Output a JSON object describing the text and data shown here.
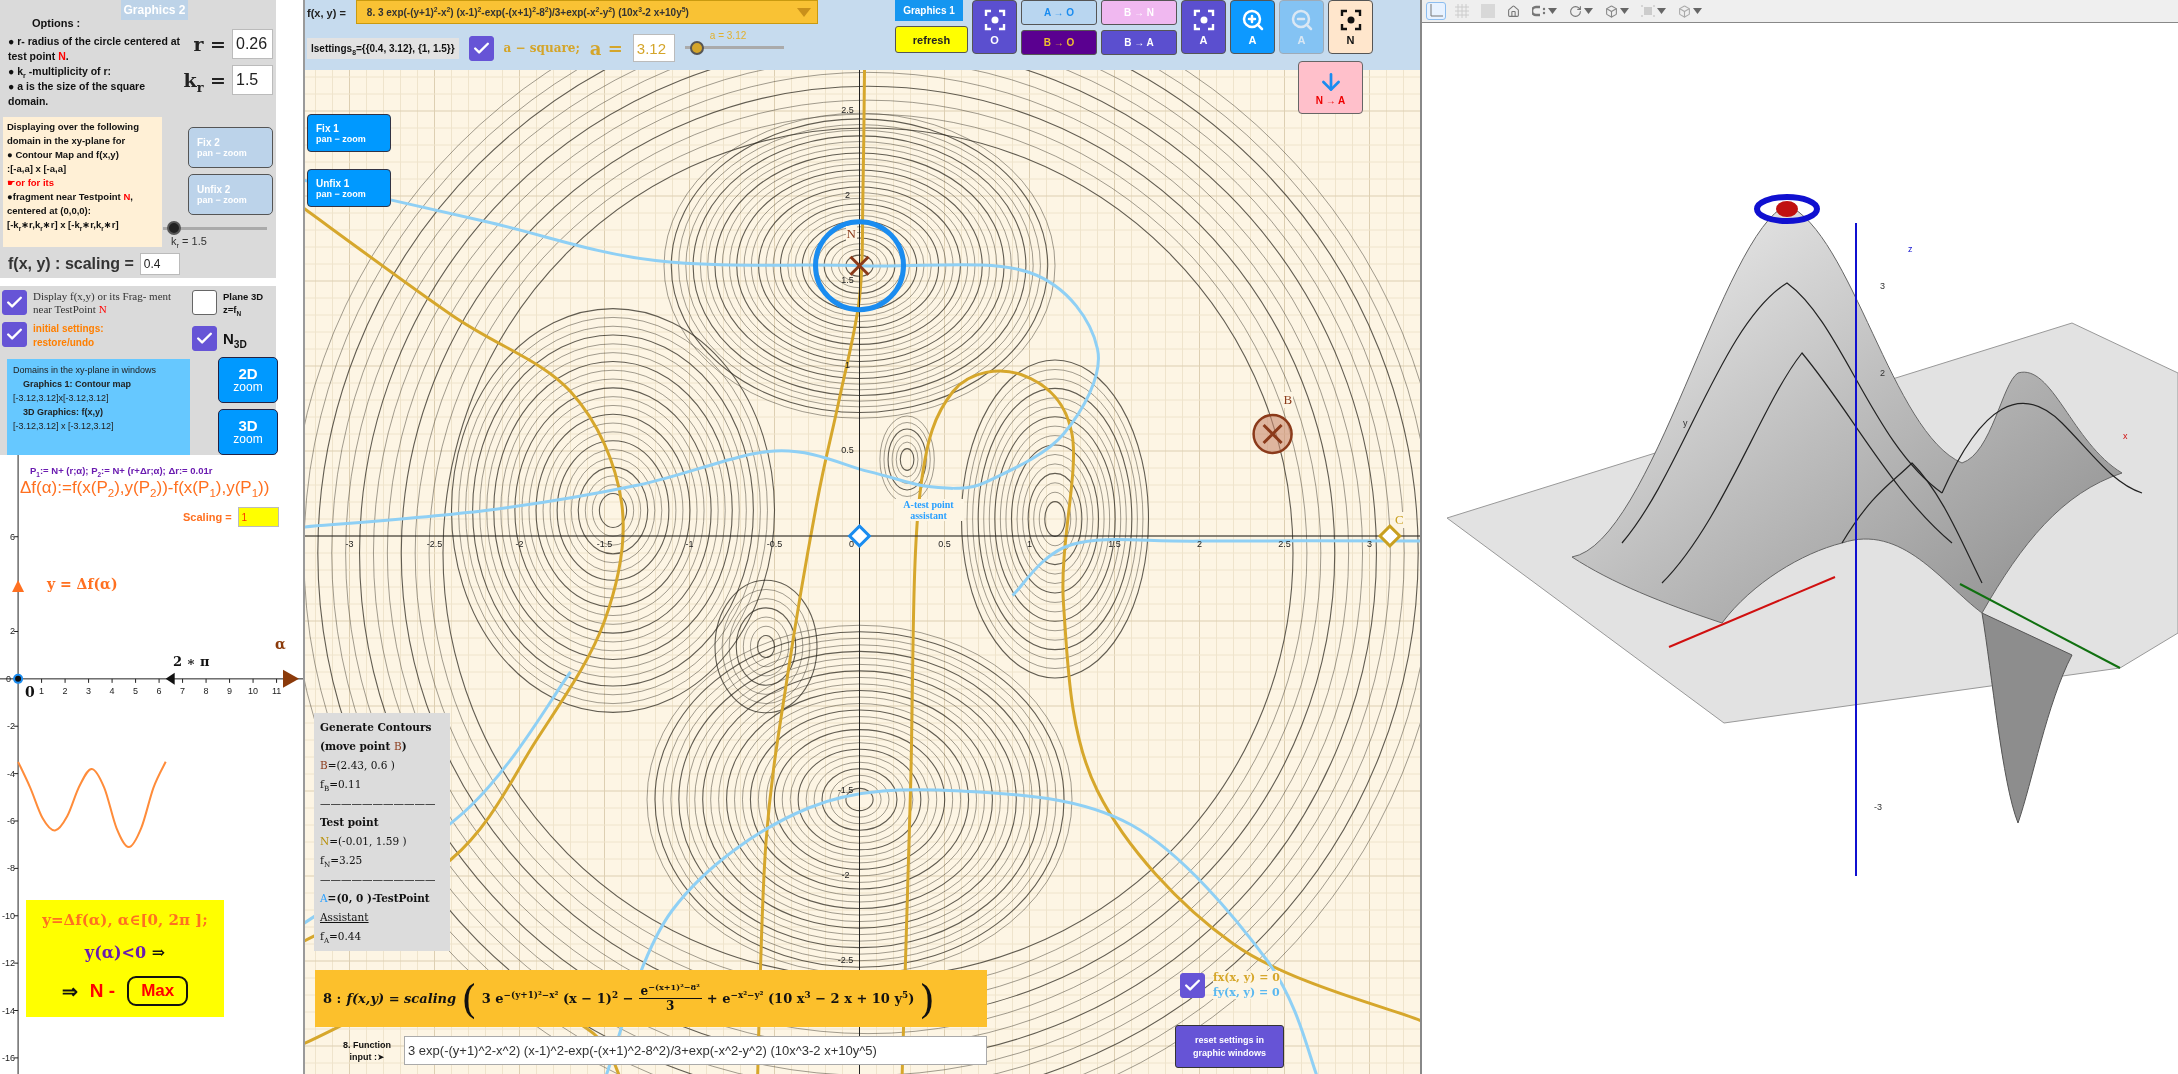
{
  "graphics2": {
    "tab_label": "Graphics 2",
    "options_title": "Options :",
    "option_lines": [
      [
        {
          "t": "● r- radius of the circle centered at test point ",
          "kind": "plain"
        },
        {
          "t": "N",
          "kind": "red"
        },
        {
          "t": ".",
          "kind": "plain"
        }
      ],
      [
        {
          "t": "● k$_{r}$ -multiplicity of  r:",
          "kind": "plain"
        }
      ],
      [
        {
          "t": "● a is the size of the square domain.",
          "kind": "plain"
        }
      ]
    ],
    "r_field": {
      "label": "r =",
      "value": "0.26"
    },
    "kr_field": {
      "label": "k$_{r}$ =",
      "value": "1.5"
    },
    "domain_note": [
      [
        {
          "t": "Displaying over the following domain in the xy-plane for",
          "kind": "plain"
        }
      ],
      [
        {
          "t": "● Contour Map and f(x,y)",
          "kind": "plain"
        }
      ],
      [
        {
          "t": ":[-a,a] x [-a,a]",
          "kind": "plain"
        }
      ],
      [
        {
          "t": "☛or for its",
          "kind": "red"
        }
      ],
      [
        {
          "t": "●fragment near Testpoint ",
          "kind": "plain"
        },
        {
          "t": "N",
          "kind": "red"
        },
        {
          "t": ",",
          "kind": "plain"
        }
      ],
      [
        {
          "t": "centered  at (0,0,0):",
          "kind": "plain"
        }
      ],
      [
        {
          "t": "[-k$_{r}$∗r,k$_{r}$∗r] x [-k$_{r}$∗r,k$_{r}$∗r]",
          "kind": "plain"
        }
      ]
    ],
    "fix_buttons": [
      {
        "title": "Fix 2",
        "subtitle": "pan − zoom"
      },
      {
        "title": "Unfix 2",
        "subtitle": "pan − zoom"
      }
    ],
    "kr_slider": {
      "level": 0.11,
      "label": "k$_{r}$ = 1.5"
    },
    "scaling": {
      "label": "f(x, y) :  scaling =",
      "value": "0.4"
    },
    "display_check": {
      "checked": true,
      "text": [
        {
          "t": "Display  f(x,y) or its Frag- ment near TestPoint ",
          "kind": "plain"
        },
        {
          "t": "N",
          "kind": "red"
        }
      ]
    },
    "initial_check": {
      "checked": true,
      "text": "initial settings: restore/undo"
    },
    "plane_check": {
      "checked": false,
      "text": "Plane 3D z=f$_{N}$"
    },
    "n3d_check": {
      "checked": true,
      "text": "N$_{3D}$"
    },
    "domains_box": [
      {
        "t": "Domains in the xy-plane in windows",
        "kind": "plain"
      },
      {
        "t": "Graphics 1: Contour map",
        "kind": "heading"
      },
      {
        "t": "[-3.12,3.12]x[-3.12,3.12]",
        "kind": "plain"
      },
      {
        "t": "3D Graphics: f(x,y)",
        "kind": "heading"
      },
      {
        "t": "[-3.12,3.12] x [-3.12,3.12]",
        "kind": "plain"
      }
    ],
    "zoom_buttons": [
      {
        "title": "2D",
        "subtitle": "zoom"
      },
      {
        "title": "3D",
        "subtitle": "zoom"
      }
    ],
    "graph": {
      "p_def": "P$_{1}$:= N+ (r;α);  P$_{2}$:= N+ (r+Δr;α); Δr:= 0.01r",
      "delta_def": "Δf(α):=f(x(P$_{2}$),y(P$_{2}$))-f(x(P$_{1}$),y(P$_{1}$))",
      "scaling_label": "Scaling =",
      "scaling_value": "1",
      "curve_label": "y = Δf(α)",
      "alpha_label": "α",
      "two_pi_label": "2 ∗ π",
      "origin_label": "0",
      "chart_data": {
        "type": "line",
        "x": [
          0,
          0.52,
          1.05,
          1.57,
          2.09,
          2.62,
          3.14,
          3.67,
          4.19,
          4.71,
          5.24,
          5.76,
          6.28
        ],
        "series": [
          {
            "color": "#ff8c3a",
            "values": [
              -3.5,
              -4.6,
              -5.9,
              -6.4,
              -5.8,
              -4.5,
              -3.8,
              -4.6,
              -6.3,
              -7.1,
              -6.3,
              -4.6,
              -3.5
            ]
          }
        ],
        "xlim": [
          -0.77,
          12.21
        ],
        "ylim": [
          -16.68,
          9.45
        ],
        "xticks": [
          1,
          2,
          3,
          4,
          5,
          6,
          7,
          8,
          9,
          10,
          11
        ],
        "yticks": [
          -16,
          -14,
          -12,
          -10,
          -8,
          -6,
          -4,
          -2,
          0,
          2,
          6
        ]
      },
      "conclusion": {
        "condition": "y=Δf(α), α∈[0, 2π ];",
        "implication": [
          {
            "t": "y(α)<0 ",
            "kind": "purple"
          },
          {
            "t": "⇒",
            "kind": "plain"
          }
        ],
        "arrow": "⇒",
        "point": "N -",
        "result": "Max"
      }
    }
  },
  "graphics1": {
    "function_label": "f(x, y) =",
    "function_dropdown": "8.  3 exp(-(y+1)$^{2}$-x$^{2}$) (x-1)$^{2}$-exp(-(x+1)$^{2}$-8$^{2}$)/3+exp(-x$^{2}$-y$^{2}$) (10x$^{3}$-2 x+10y$^{5}$)",
    "settings_text": "lsettings$_{8}$={{0.4, 3.12}, {1, 1.5}}",
    "square_check": {
      "checked": true,
      "text": "a − square;"
    },
    "a_field": {
      "label": "a =",
      "value": "3.12"
    },
    "a_slider": {
      "level": 0.12,
      "label": "a = 3.12"
    },
    "view_label": "Graphics 1",
    "refresh_button": "refresh",
    "frame_o": {
      "caption": "O"
    },
    "moves": [
      {
        "top": "A → O",
        "bottom": "B → O"
      },
      {
        "top": "B → N",
        "bottom": "B → A"
      }
    ],
    "frame_a": {
      "caption": "A"
    },
    "zoom_in": {
      "caption": "A",
      "disabled": false
    },
    "zoom_out": {
      "caption": "A",
      "disabled": true
    },
    "frame_n": {
      "caption": "N"
    },
    "n_to_a": {
      "caption": "N → A"
    },
    "fix_buttons": [
      {
        "title": "Fix 1",
        "subtitle": "pan − zoom"
      },
      {
        "title": "Unfix 1",
        "subtitle": "pan − zoom"
      }
    ],
    "x_ticks": [
      "-3",
      "-2.5",
      "-2",
      "-1.5",
      "-1",
      "-0.5",
      "0",
      "0.5",
      "1",
      "1.5",
      "2",
      "2.5",
      "3"
    ],
    "y_ticks_upper": [
      "2.5",
      "2",
      "1.5",
      "1",
      "0.5"
    ],
    "y_ticks_lower": [
      "-1.5",
      "-2",
      "-2.5"
    ],
    "point_labels": [
      "N",
      "B",
      "C"
    ],
    "assistant_label": "A-test point assistant",
    "info_box": [
      [
        {
          "t": "Generate Contours",
          "kind": "bold"
        }
      ],
      [
        {
          "t": "(move point  ",
          "kind": "bold"
        },
        {
          "t": "B",
          "kind": "brown"
        },
        {
          "t": ")",
          "kind": "bold"
        }
      ],
      [
        {
          "t": "B",
          "kind": "brown"
        },
        {
          "t": "=(2.43, 0.6 )",
          "kind": "value"
        }
      ],
      [
        {
          "t": "f$_{B}$=0.11",
          "kind": "value"
        }
      ],
      [
        {
          "t": "———————————",
          "kind": "plain"
        }
      ],
      [
        {
          "t": "Test point",
          "kind": "bold"
        }
      ],
      [
        {
          "t": "N",
          "kind": "gold"
        },
        {
          "t": "=(-0.01, 1.59 )",
          "kind": "value"
        }
      ],
      [
        {
          "t": "f$_{N}$=3.25",
          "kind": "value"
        }
      ],
      [
        {
          "t": "———————————",
          "kind": "plain"
        }
      ],
      [
        {
          "t": "A",
          "kind": "blue"
        },
        {
          "t": "=(0, 0 )-TestPoint",
          "kind": "bold"
        }
      ],
      [
        {
          "t": "Assistant",
          "kind": "underline"
        }
      ],
      [
        {
          "t": "f$_{A}$=0.44",
          "kind": "value"
        }
      ]
    ],
    "formula": {
      "label": "8 :",
      "lhs": "f(x,y) = scaling",
      "open": "(",
      "term1": "3 e$^{−(y+1)²−x²}$ (x − 1)$^{2}$ −",
      "numerator": "e$^{−(x+1)²−8²}$",
      "denominator": "3",
      "term2": "+ e$^{−x²−y²}$ (10 x$^{3}$ − 2 x + 10 y$^{5}$)",
      "close": ")"
    },
    "input_label": "8. Function input :➤",
    "function_input": "3 exp(-(y+1)^2-x^2) (x-1)^2-exp(-(x+1)^2-8^2)/3+exp(-x^2-y^2) (10x^3-2 x+10y^5)",
    "legend": {
      "checked": true,
      "fx": "fx(x, y) = 0",
      "fy": "fy(x, y) = 0"
    },
    "reset_button": "reset settings  in graphic windows"
  },
  "graphics3d": {
    "axis_labels": [
      "z",
      "3",
      "2",
      "-3",
      "x",
      "y"
    ]
  }
}
